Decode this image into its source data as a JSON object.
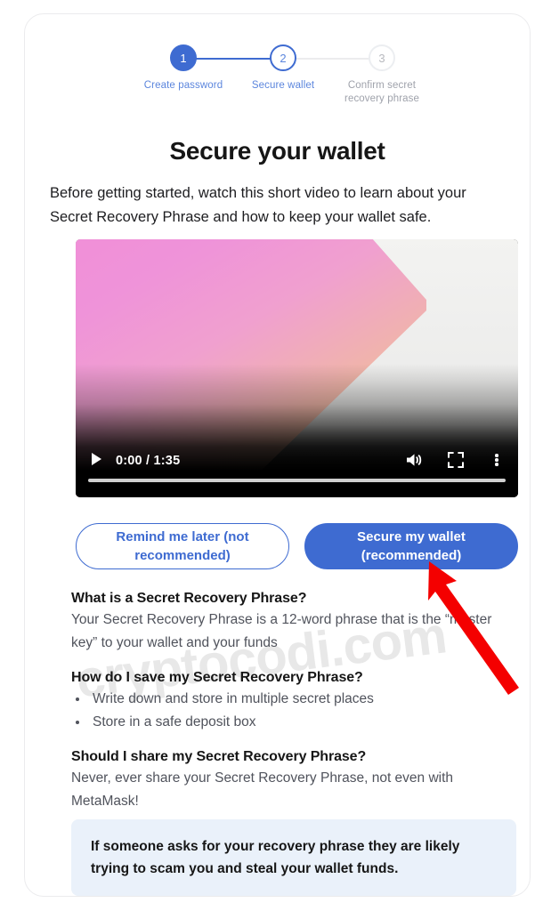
{
  "colors": {
    "accent_blue": "#3e6bd1",
    "step_label_blue": "#5c86dd",
    "step_label_gray": "#9fa2ab",
    "callout_bg": "#eaf1fa",
    "arrow_red": "#f40000",
    "text_dark": "#161616",
    "text_body": "#50535c"
  },
  "stepper": {
    "steps": [
      {
        "number": "1",
        "label": "Create password",
        "state": "done"
      },
      {
        "number": "2",
        "label": "Secure wallet",
        "state": "active"
      },
      {
        "number": "3",
        "label": "Confirm secret recovery phrase",
        "state": "todo"
      }
    ]
  },
  "header": {
    "title": "Secure your wallet",
    "subtitle": "Before getting started, watch this short video to learn about your Secret Recovery Phrase and how to keep your wallet safe."
  },
  "video": {
    "current_time": "0:00",
    "duration": "1:35",
    "time_display": "0:00 / 1:35",
    "progress_percent": 0,
    "controls": {
      "play_icon": "play-icon",
      "volume_icon": "volume-icon",
      "fullscreen_icon": "fullscreen-icon",
      "more_icon": "kebab-menu-icon"
    }
  },
  "actions": {
    "secondary_label": "Remind me later (not recommended)",
    "primary_label": "Secure my wallet (recommended)"
  },
  "faq": [
    {
      "question": "What is a Secret Recovery Phrase?",
      "answer": "Your Secret Recovery Phrase is a 12-word phrase that is the “master key” to your wallet and your funds",
      "items": []
    },
    {
      "question": "How do I save my Secret Recovery Phrase?",
      "answer": "",
      "items": [
        "Write down and store in multiple secret places",
        "Store in a safe deposit box"
      ]
    },
    {
      "question": "Should I share my Secret Recovery Phrase?",
      "answer": "Never, ever share your Secret Recovery Phrase, not even with MetaMask!",
      "items": []
    }
  ],
  "callout": {
    "text": "If someone asks for your recovery phrase they are likely trying to scam you and steal your wallet funds."
  },
  "watermark": {
    "text": "cryptocodi.com"
  },
  "annotation": {
    "type": "red-arrow",
    "points_to": "Secure my wallet (recommended)"
  }
}
